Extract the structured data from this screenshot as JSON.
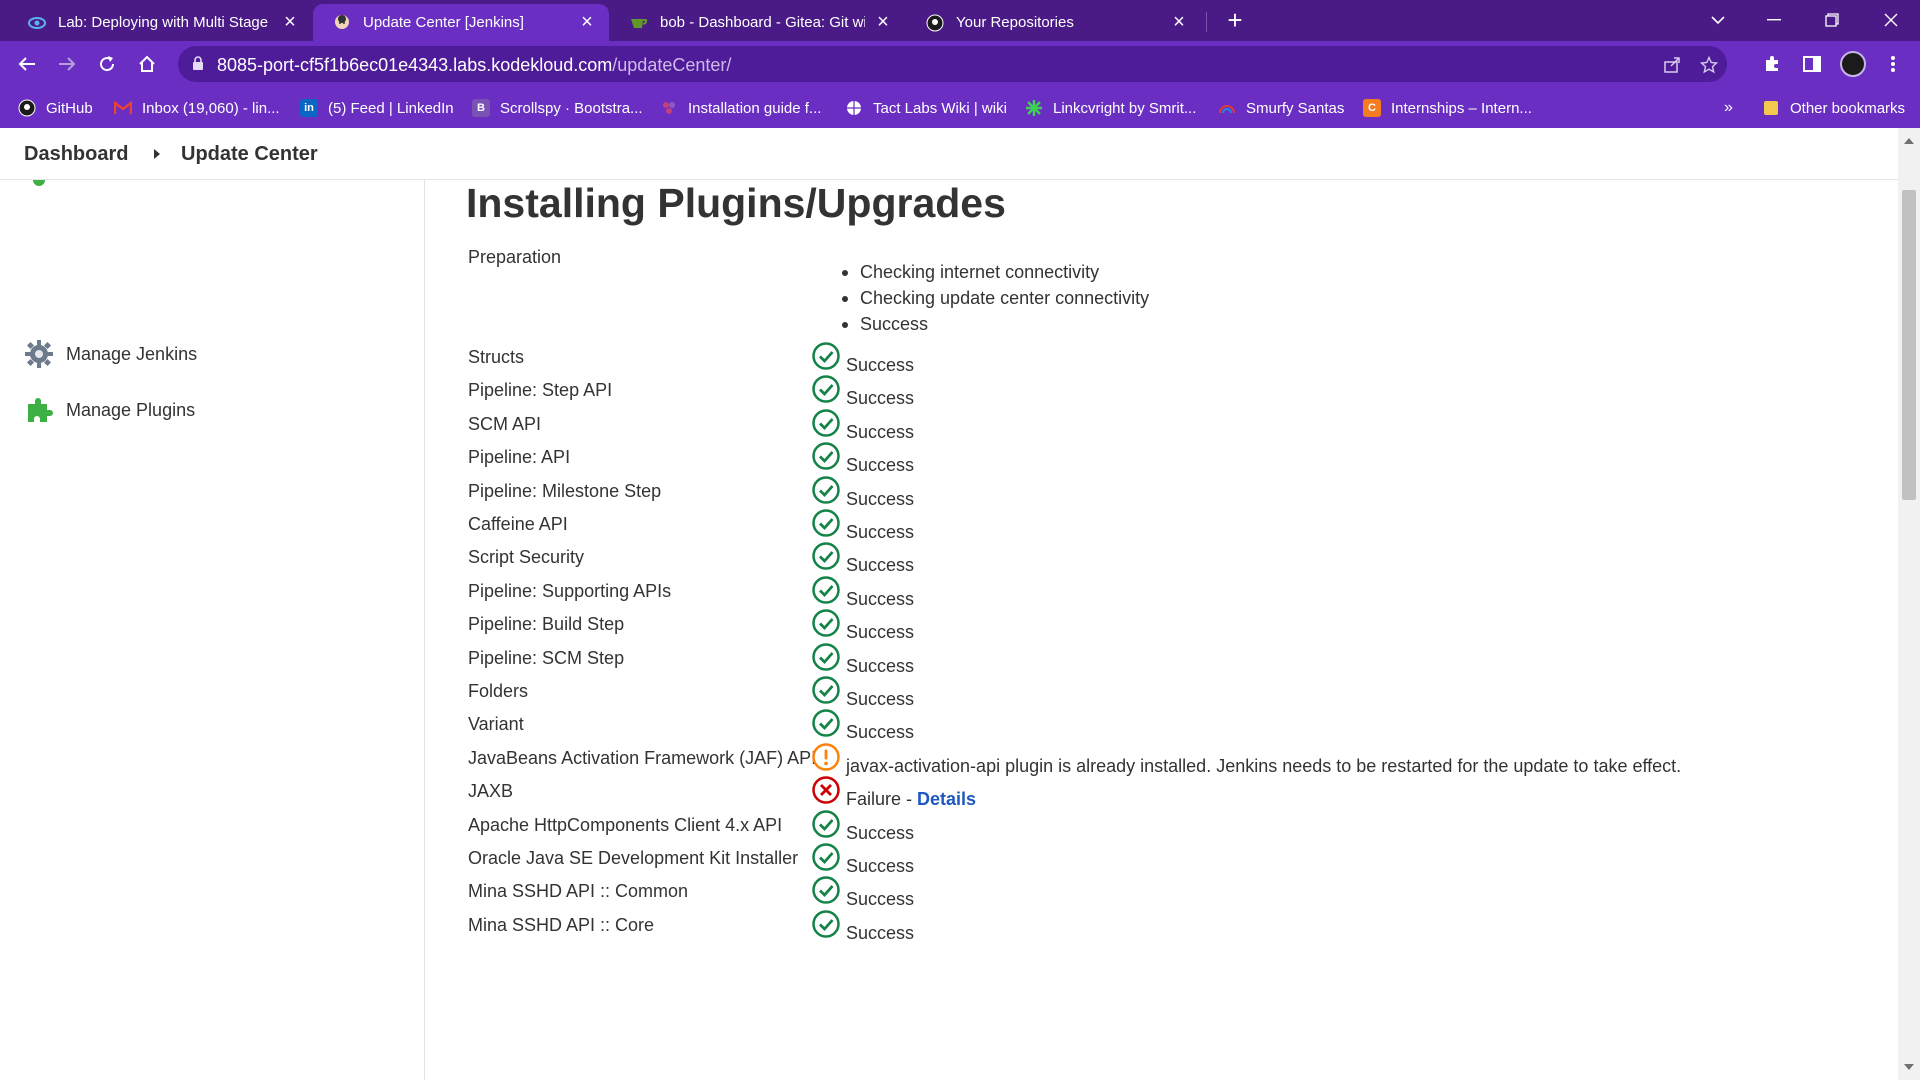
{
  "browser": {
    "tabs": [
      {
        "title": "Lab: Deploying with Multi Stage I",
        "favicon": "eye-icon",
        "active": false
      },
      {
        "title": "Update Center [Jenkins]",
        "favicon": "jenkins-icon",
        "active": true
      },
      {
        "title": "bob - Dashboard - Gitea: Git with",
        "favicon": "gitea-icon",
        "active": false
      },
      {
        "title": "Your Repositories",
        "favicon": "github-icon",
        "active": false
      }
    ],
    "new_tab": "+",
    "url_host": "8085-port-cf5f1b6ec01e4343.labs.kodekloud.com",
    "url_path": "/updateCenter/",
    "bookmarks": [
      {
        "label": "GitHub",
        "icon": "github-icon"
      },
      {
        "label": "Inbox (19,060) - lin...",
        "icon": "gmail-icon"
      },
      {
        "label": "(5) Feed | LinkedIn",
        "icon": "linkedin-icon"
      },
      {
        "label": "Scrollspy · Bootstra...",
        "icon": "bootstrap-icon"
      },
      {
        "label": "Installation guide f...",
        "icon": "puzzle-icon"
      },
      {
        "label": "Tact Labs Wiki | wiki",
        "icon": "globe-icon"
      },
      {
        "label": "Linkcvright by Smrit...",
        "icon": "star-icon"
      },
      {
        "label": "Smurfy Santas",
        "icon": "rainbow-icon"
      },
      {
        "label": "Internships – Intern...",
        "icon": "c-icon"
      }
    ],
    "bookmarks_overflow": "»",
    "other_bookmarks": "Other bookmarks"
  },
  "breadcrumb": {
    "dashboard": "Dashboard",
    "current": "Update Center"
  },
  "sidebar": {
    "items": [
      {
        "label": "Manage Jenkins",
        "icon": "gear-icon"
      },
      {
        "label": "Manage Plugins",
        "icon": "puzzle-icon"
      }
    ]
  },
  "main": {
    "title": "Installing Plugins/Upgrades",
    "preparation_label": "Preparation",
    "preparation_steps": [
      "Checking internet connectivity",
      "Checking update center connectivity",
      "Success"
    ],
    "plugins": [
      {
        "name": "Structs",
        "status": "success",
        "text": "Success"
      },
      {
        "name": "Pipeline: Step API",
        "status": "success",
        "text": "Success"
      },
      {
        "name": "SCM API",
        "status": "success",
        "text": "Success"
      },
      {
        "name": "Pipeline: API",
        "status": "success",
        "text": "Success"
      },
      {
        "name": "Pipeline: Milestone Step",
        "status": "success",
        "text": "Success"
      },
      {
        "name": "Caffeine API",
        "status": "success",
        "text": "Success"
      },
      {
        "name": "Script Security",
        "status": "success",
        "text": "Success"
      },
      {
        "name": "Pipeline: Supporting APIs",
        "status": "success",
        "text": "Success"
      },
      {
        "name": "Pipeline: Build Step",
        "status": "success",
        "text": "Success"
      },
      {
        "name": "Pipeline: SCM Step",
        "status": "success",
        "text": "Success"
      },
      {
        "name": "Folders",
        "status": "success",
        "text": "Success"
      },
      {
        "name": "Variant",
        "status": "success",
        "text": "Success"
      },
      {
        "name": "JavaBeans Activation Framework (JAF) API",
        "status": "warning",
        "text": "javax-activation-api plugin is already installed. Jenkins needs to be restarted for the update to take effect."
      },
      {
        "name": "JAXB",
        "status": "failure",
        "text": "Failure - ",
        "link": "Details"
      },
      {
        "name": "Apache HttpComponents Client 4.x API",
        "status": "success",
        "text": "Success"
      },
      {
        "name": "Oracle Java SE Development Kit Installer",
        "status": "success",
        "text": "Success"
      },
      {
        "name": "Mina SSHD API :: Common",
        "status": "success",
        "text": "Success"
      },
      {
        "name": "Mina SSHD API :: Core",
        "status": "success",
        "text": "Success"
      }
    ]
  },
  "colors": {
    "chrome_dark": "#4a1a87",
    "chrome": "#6a2fc2",
    "success": "#138347",
    "warning": "#fe820a",
    "failure": "#cc0003",
    "link": "#1e58bf"
  }
}
